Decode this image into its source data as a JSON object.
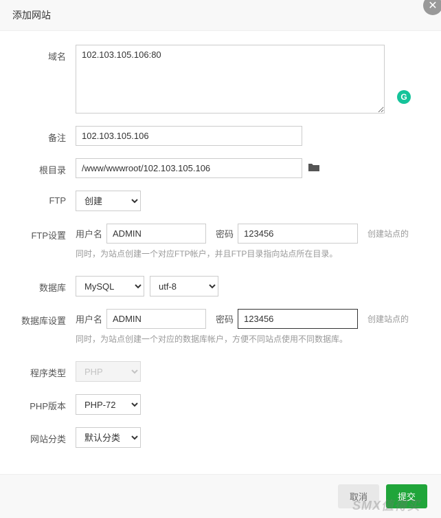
{
  "header": {
    "title": "添加网站"
  },
  "close": "✕",
  "domain": {
    "label": "域名",
    "value": "102.103.105.106:80"
  },
  "remark": {
    "label": "备注",
    "value": "102.103.105.106"
  },
  "root": {
    "label": "根目录",
    "value": "/www/wwwroot/102.103.105.106"
  },
  "ftp": {
    "label": "FTP",
    "value": "创建"
  },
  "ftp_settings": {
    "label": "FTP设置",
    "user_label": "用户名",
    "user_value": "ADMIN",
    "pass_label": "密码",
    "pass_value": "123456",
    "right_text": "创建站点的",
    "hint": "同时，为站点创建一个对应FTP帐户，并且FTP目录指向站点所在目录。"
  },
  "database": {
    "label": "数据库",
    "engine": "MySQL",
    "charset": "utf-8"
  },
  "db_settings": {
    "label": "数据库设置",
    "user_label": "用户名",
    "user_value": "ADMIN",
    "pass_label": "密码",
    "pass_value": "123456",
    "right_text": "创建站点的",
    "hint": "同时，为站点创建一个对应的数据库帐户，方便不同站点使用不同数据库。"
  },
  "program": {
    "label": "程序类型",
    "value": "PHP"
  },
  "php": {
    "label": "PHP版本",
    "value": "PHP-72"
  },
  "category": {
    "label": "网站分类",
    "value": "默认分类"
  },
  "footer": {
    "cancel": "取消",
    "submit": "提交"
  },
  "watermark": "SMX值得买"
}
